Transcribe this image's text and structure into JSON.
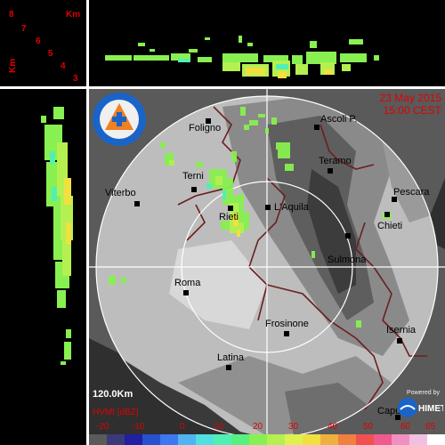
{
  "header": {
    "date": "23 May 2015",
    "time": "15:00 CEST"
  },
  "km_scale": {
    "unit": "Km",
    "ticks": [
      "8",
      "7",
      "6",
      "5",
      "4",
      "3"
    ]
  },
  "logo": {
    "agency": "PROTEZIONE CIVILE",
    "region": "REGIONE ABRUZZO"
  },
  "cities": [
    {
      "name": "Foligno"
    },
    {
      "name": "Ascoli P."
    },
    {
      "name": "Teramo"
    },
    {
      "name": "Terni"
    },
    {
      "name": "Viterbo"
    },
    {
      "name": "Pescara"
    },
    {
      "name": "Rieti"
    },
    {
      "name": "L'Aquila"
    },
    {
      "name": "Chieti"
    },
    {
      "name": "Sulmona"
    },
    {
      "name": "Roma"
    },
    {
      "name": "Frosinone"
    },
    {
      "name": "Isernia"
    },
    {
      "name": "Latina"
    },
    {
      "name": "Capua"
    }
  ],
  "range_label": "120.0Km",
  "product_label": "HVMI [dBZ]",
  "powered_by": "Powered by",
  "brand": "HIMET",
  "colorbar": {
    "labels": [
      "-20",
      "-10",
      "0",
      "10",
      "20",
      "30",
      "40",
      "50",
      "60",
      "65"
    ],
    "colors": [
      "#5a5a5a",
      "#3a3a7a",
      "#2020a0",
      "#2850d0",
      "#3c78f0",
      "#50b4f0",
      "#50e0e0",
      "#50f0b4",
      "#58f080",
      "#88f050",
      "#b4f050",
      "#e0f050",
      "#f0e040",
      "#f0b040",
      "#f08040",
      "#f05050",
      "#f05a8c",
      "#f090c0",
      "#f0c0e0",
      "#ffffff"
    ]
  }
}
